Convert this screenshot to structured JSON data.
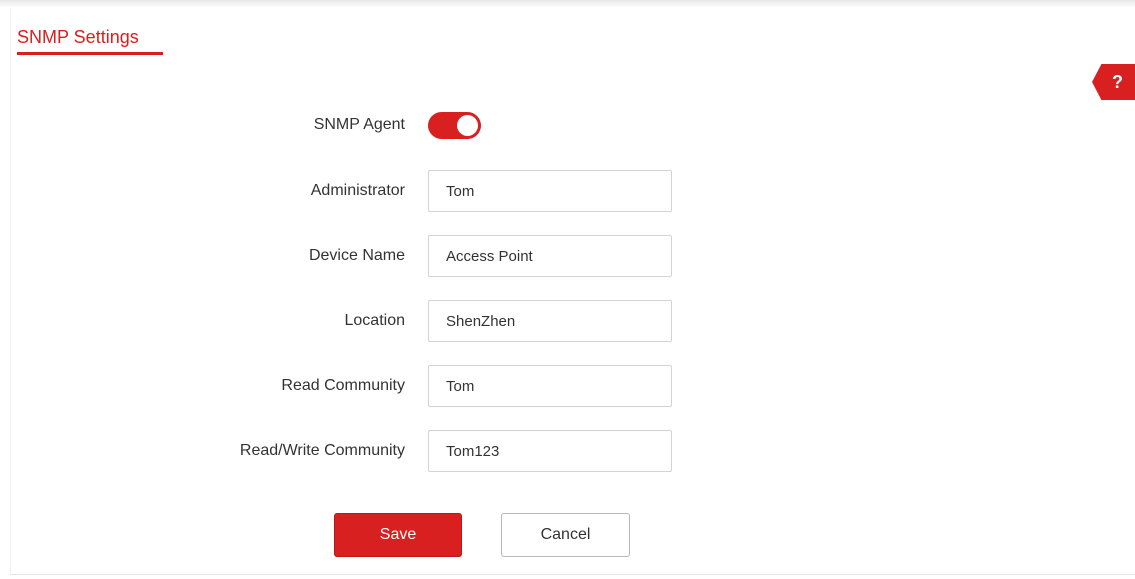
{
  "header": {
    "title": "SNMP Settings"
  },
  "help": {
    "icon_text": "?"
  },
  "form": {
    "snmp_agent": {
      "label": "SNMP Agent",
      "enabled": true
    },
    "administrator": {
      "label": "Administrator",
      "value": "Tom"
    },
    "device_name": {
      "label": "Device Name",
      "value": "Access Point"
    },
    "location": {
      "label": "Location",
      "value": "ShenZhen"
    },
    "read_community": {
      "label": "Read Community",
      "value": "Tom"
    },
    "read_write_community": {
      "label": "Read/Write Community",
      "value": "Tom123"
    }
  },
  "buttons": {
    "save_label": "Save",
    "cancel_label": "Cancel"
  },
  "colors": {
    "accent": "#d7201f",
    "text": "#333333",
    "border": "#d3d3d3"
  },
  "icons": {
    "help": "help-icon",
    "toggle": "toggle-switch"
  }
}
